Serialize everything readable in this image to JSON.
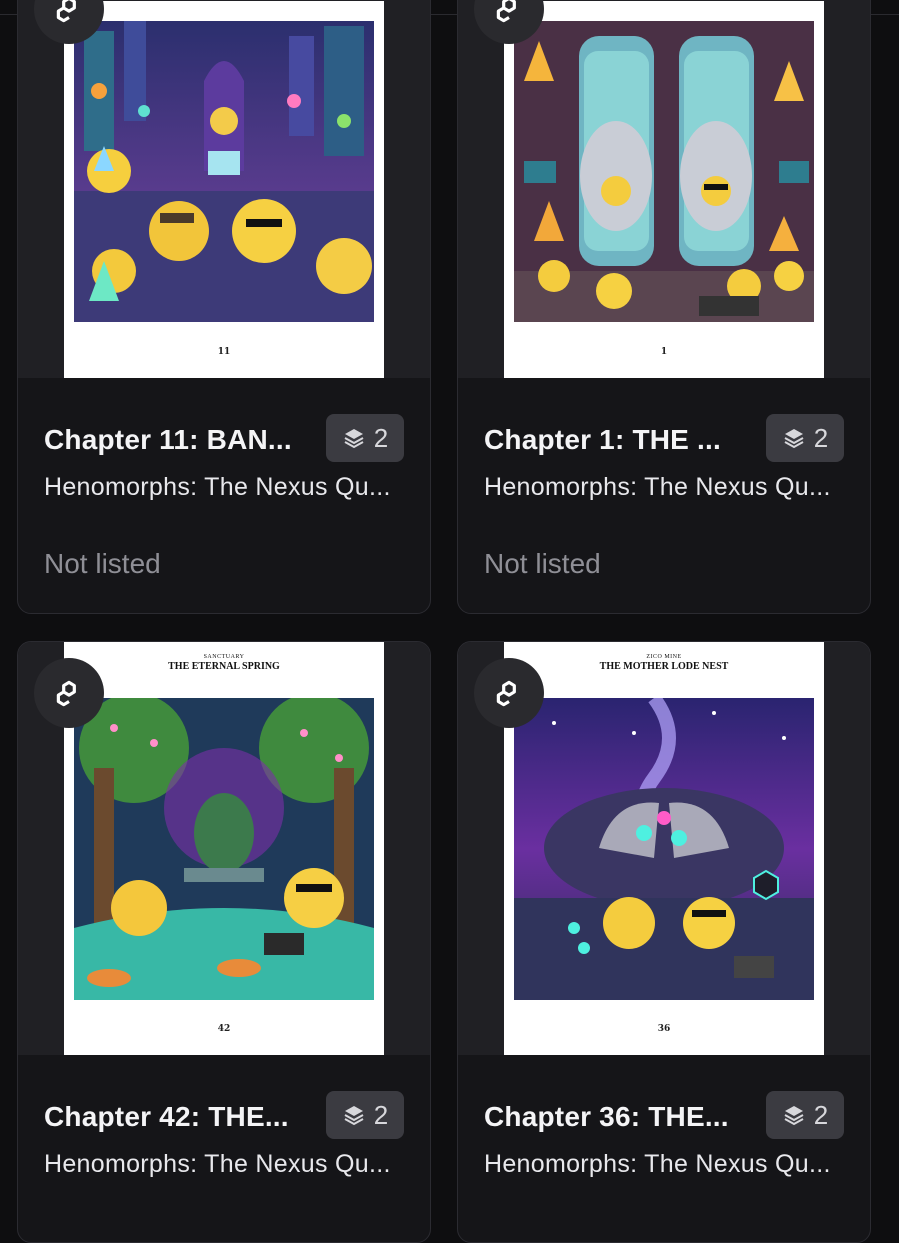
{
  "cards": [
    {
      "title": "Chapter 11: BAN...",
      "edition_count": "2",
      "collection": "Henomorphs: The Nexus Qu...",
      "status": "Not listed",
      "page_number": "11",
      "page_kicker": "",
      "page_title": "",
      "badge_icon": "polygon-logo-icon",
      "edition_icon": "layers-icon"
    },
    {
      "title": "Chapter 1: THE ...",
      "edition_count": "2",
      "collection": "Henomorphs: The Nexus Qu...",
      "status": "Not listed",
      "page_number": "1",
      "page_kicker": "",
      "page_title": "",
      "badge_icon": "polygon-logo-icon",
      "edition_icon": "layers-icon"
    },
    {
      "title": "Chapter 42: THE...",
      "edition_count": "2",
      "collection": "Henomorphs: The Nexus Qu...",
      "status": "",
      "page_number": "42",
      "page_kicker": "SANCTUARY",
      "page_title": "THE ETERNAL SPRING",
      "badge_icon": "polygon-logo-icon",
      "edition_icon": "layers-icon"
    },
    {
      "title": "Chapter 36: THE...",
      "edition_count": "2",
      "collection": "Henomorphs: The Nexus Qu...",
      "status": "",
      "page_number": "36",
      "page_kicker": "ZICO MINE",
      "page_title": "THE MOTHER LODE NEST",
      "badge_icon": "polygon-logo-icon",
      "edition_icon": "layers-icon"
    }
  ],
  "colors": {
    "background": "#0e0e10",
    "card": "#151518",
    "badge": "#3b3b41",
    "muted_text": "#8f8f96"
  }
}
